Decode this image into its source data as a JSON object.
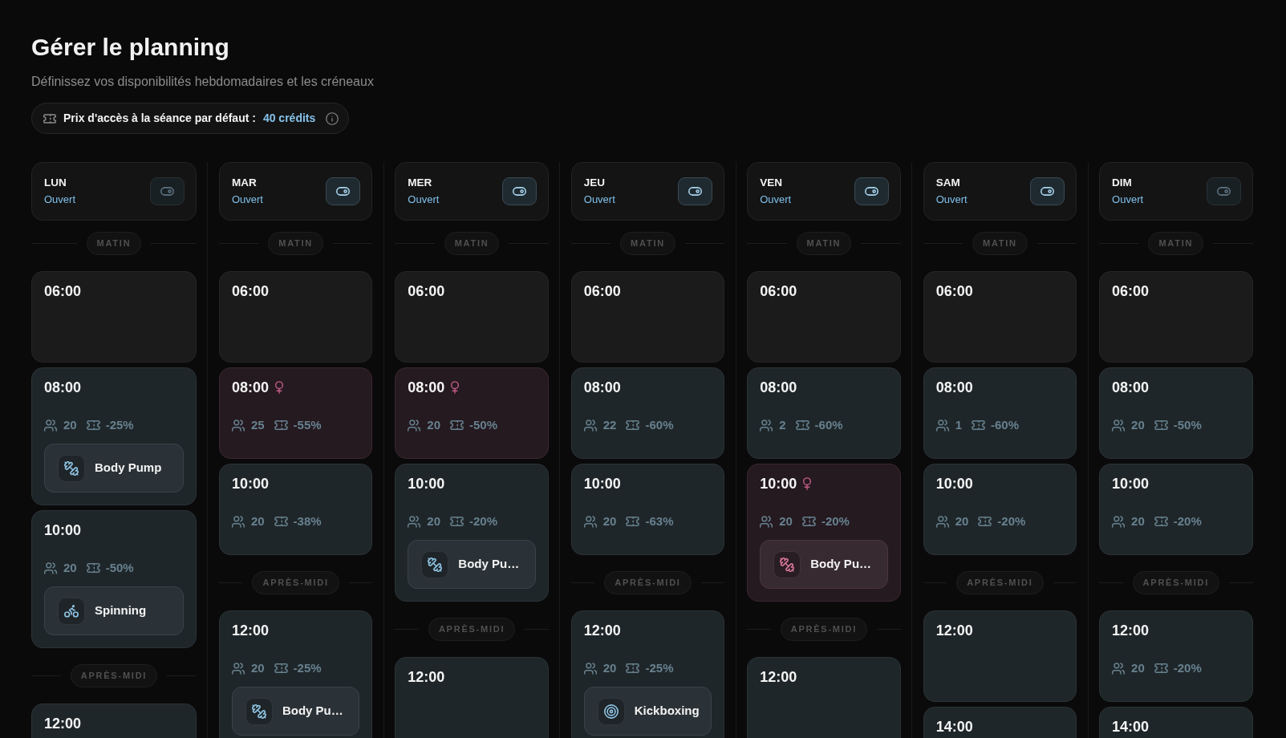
{
  "page": {
    "title": "Gérer le planning",
    "subtitle": "Définissez vos disponibilités hebdomadaires et les créneaux"
  },
  "default_price": {
    "label": "Prix d'accès à la séance par défaut :",
    "value": "40 crédits"
  },
  "days": [
    {
      "name": "LUN",
      "status": "Ouvert",
      "toggle_dimmed": true,
      "sections": [
        {
          "label": "MATIN",
          "slots": [
            {
              "time": "06:00",
              "kind": "inactive"
            },
            {
              "time": "08:00",
              "kind": "standard",
              "capacity": "20",
              "discount": "-25%",
              "activity": {
                "name": "Body Pump",
                "kind": "dumbbell"
              }
            },
            {
              "time": "10:00",
              "kind": "standard",
              "capacity": "20",
              "discount": "-50%",
              "activity": {
                "name": "Spinning",
                "kind": "bike"
              }
            }
          ]
        },
        {
          "label": "APRÈS-MIDI",
          "slots": [
            {
              "time": "12:00",
              "kind": "standard"
            }
          ]
        }
      ]
    },
    {
      "name": "MAR",
      "status": "Ouvert",
      "toggle_dimmed": false,
      "sections": [
        {
          "label": "MATIN",
          "slots": [
            {
              "time": "06:00",
              "kind": "inactive"
            },
            {
              "time": "08:00",
              "kind": "women",
              "capacity": "25",
              "discount": "-55%"
            },
            {
              "time": "10:00",
              "kind": "standard",
              "capacity": "20",
              "discount": "-38%"
            }
          ]
        },
        {
          "label": "APRÈS-MIDI",
          "slots": [
            {
              "time": "12:00",
              "kind": "standard",
              "capacity": "20",
              "discount": "-25%",
              "activity": {
                "name": "Body Pu…",
                "kind": "dumbbell"
              }
            }
          ]
        }
      ]
    },
    {
      "name": "MER",
      "status": "Ouvert",
      "toggle_dimmed": false,
      "sections": [
        {
          "label": "MATIN",
          "slots": [
            {
              "time": "06:00",
              "kind": "inactive"
            },
            {
              "time": "08:00",
              "kind": "women",
              "capacity": "20",
              "discount": "-50%"
            },
            {
              "time": "10:00",
              "kind": "standard",
              "capacity": "20",
              "discount": "-20%",
              "activity": {
                "name": "Body Pu…",
                "kind": "dumbbell"
              }
            }
          ]
        },
        {
          "label": "APRÈS-MIDI",
          "slots": [
            {
              "time": "12:00",
              "kind": "standard"
            }
          ]
        }
      ]
    },
    {
      "name": "JEU",
      "status": "Ouvert",
      "toggle_dimmed": false,
      "sections": [
        {
          "label": "MATIN",
          "slots": [
            {
              "time": "06:00",
              "kind": "inactive"
            },
            {
              "time": "08:00",
              "kind": "standard",
              "capacity": "22",
              "discount": "-60%"
            },
            {
              "time": "10:00",
              "kind": "standard",
              "capacity": "20",
              "discount": "-63%"
            }
          ]
        },
        {
          "label": "APRÈS-MIDI",
          "slots": [
            {
              "time": "12:00",
              "kind": "standard",
              "capacity": "20",
              "discount": "-25%",
              "activity": {
                "name": "Kickboxing",
                "kind": "target"
              }
            }
          ]
        }
      ]
    },
    {
      "name": "VEN",
      "status": "Ouvert",
      "toggle_dimmed": false,
      "sections": [
        {
          "label": "MATIN",
          "slots": [
            {
              "time": "06:00",
              "kind": "inactive"
            },
            {
              "time": "08:00",
              "kind": "standard",
              "capacity": "2",
              "discount": "-60%"
            },
            {
              "time": "10:00",
              "kind": "women",
              "capacity": "20",
              "discount": "-20%",
              "activity": {
                "name": "Body Pu…",
                "kind": "dumbbell"
              }
            }
          ]
        },
        {
          "label": "APRÈS-MIDI",
          "slots": [
            {
              "time": "12:00",
              "kind": "standard"
            }
          ]
        }
      ]
    },
    {
      "name": "SAM",
      "status": "Ouvert",
      "toggle_dimmed": false,
      "sections": [
        {
          "label": "MATIN",
          "slots": [
            {
              "time": "06:00",
              "kind": "inactive"
            },
            {
              "time": "08:00",
              "kind": "standard",
              "capacity": "1",
              "discount": "-60%"
            },
            {
              "time": "10:00",
              "kind": "standard",
              "capacity": "20",
              "discount": "-20%"
            }
          ]
        },
        {
          "label": "APRÈS-MIDI",
          "slots": [
            {
              "time": "12:00",
              "kind": "standard"
            },
            {
              "time": "14:00",
              "kind": "standard"
            }
          ]
        }
      ]
    },
    {
      "name": "DIM",
      "status": "Ouvert",
      "toggle_dimmed": true,
      "sections": [
        {
          "label": "MATIN",
          "slots": [
            {
              "time": "06:00",
              "kind": "inactive"
            },
            {
              "time": "08:00",
              "kind": "standard",
              "capacity": "20",
              "discount": "-50%"
            },
            {
              "time": "10:00",
              "kind": "standard",
              "capacity": "20",
              "discount": "-20%"
            }
          ]
        },
        {
          "label": "APRÈS-MIDI",
          "slots": [
            {
              "time": "12:00",
              "kind": "standard",
              "capacity": "20",
              "discount": "-20%"
            },
            {
              "time": "14:00",
              "kind": "standard"
            }
          ]
        }
      ]
    }
  ]
}
